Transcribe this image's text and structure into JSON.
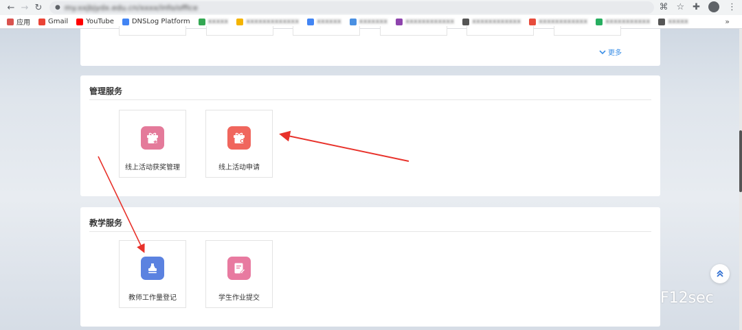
{
  "browser": {
    "url": "my.xxjbjydx.edu.cn/xxxx/info/office",
    "bookmarks": [
      {
        "label": "应用",
        "color": "#d9534f",
        "blur": false
      },
      {
        "label": "Gmail",
        "color": "#ea4335",
        "blur": false
      },
      {
        "label": "YouTube",
        "color": "#ff0000",
        "blur": false
      },
      {
        "label": "DNSLog Platform",
        "color": "#4285f4",
        "blur": false
      },
      {
        "label": "xxxxx",
        "color": "#34a853",
        "blur": true
      },
      {
        "label": "xxxxxxxxxxxxx",
        "color": "#f4b400",
        "blur": true
      },
      {
        "label": "xxxxxx",
        "color": "#4285f4",
        "blur": true
      },
      {
        "label": "xxxxxxx",
        "color": "#4a90e2",
        "blur": true
      },
      {
        "label": "xxxxxxxxxxxx",
        "color": "#8e44ad",
        "blur": true
      },
      {
        "label": "xxxxxxxxxxxx",
        "color": "#555555",
        "blur": true
      },
      {
        "label": "xxxxxxxxxxxx",
        "color": "#e74c3c",
        "blur": true
      },
      {
        "label": "xxxxxxxxxxx",
        "color": "#27ae60",
        "blur": true
      },
      {
        "label": "xxxxx",
        "color": "#555555",
        "blur": true
      }
    ],
    "more": "»"
  },
  "top_section": {
    "more_label": "更多"
  },
  "management": {
    "title": "管理服务",
    "tiles": [
      {
        "label": "线上活动获奖管理",
        "color": "#e47a9a",
        "icon": "gift-star-icon"
      },
      {
        "label": "线上活动申请",
        "color": "#f0665d",
        "icon": "gift-settings-icon"
      }
    ]
  },
  "teaching": {
    "title": "教学服务",
    "tiles": [
      {
        "label": "教师工作量登记",
        "color": "#5b82e0",
        "icon": "stamp-icon"
      },
      {
        "label": "学生作业提交",
        "color": "#e87aa0",
        "icon": "document-edit-icon"
      }
    ]
  },
  "watermark": "F12sec"
}
